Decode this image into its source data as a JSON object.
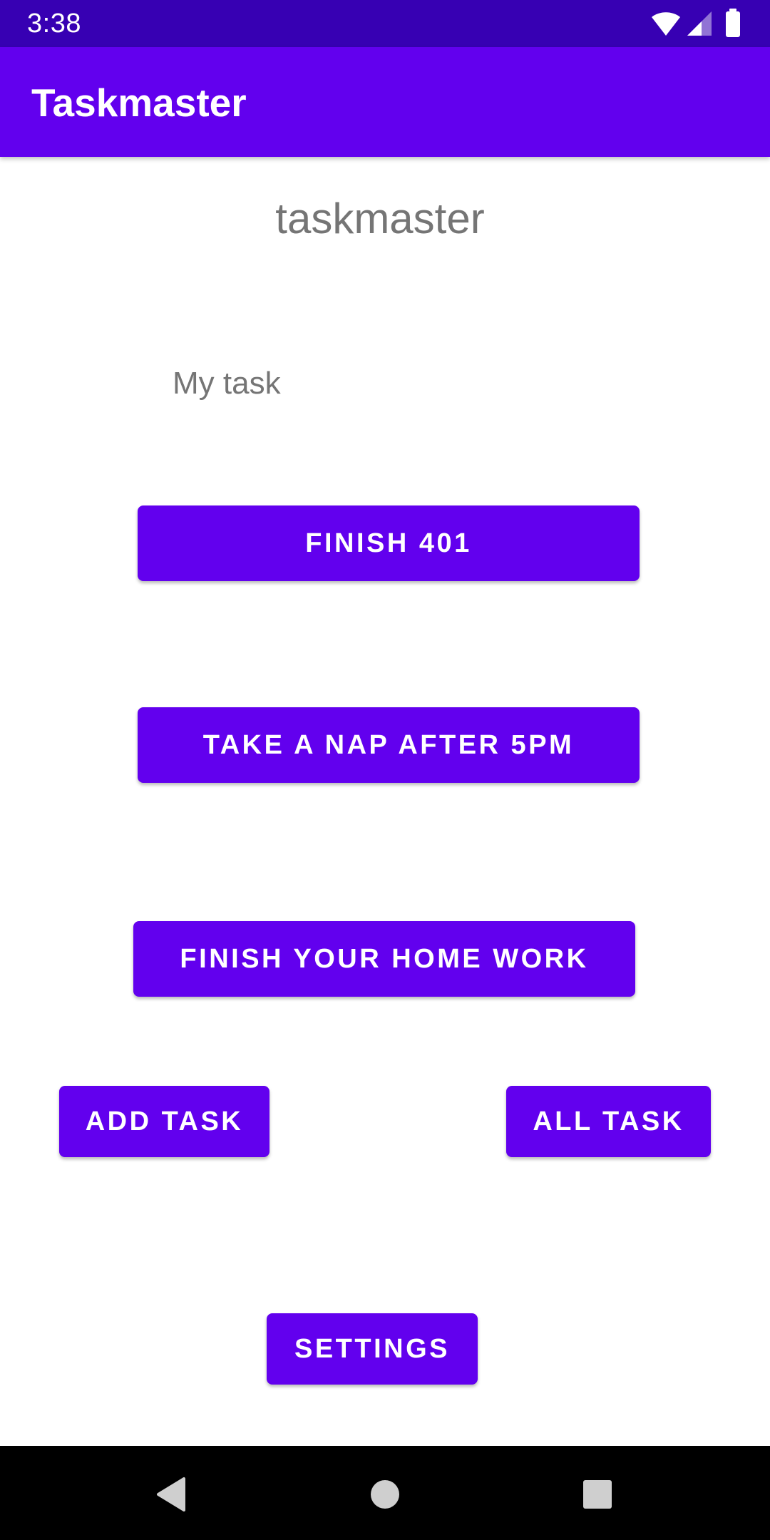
{
  "status_bar": {
    "time": "3:38",
    "icons": [
      "wifi-icon",
      "cellular-signal-icon",
      "battery-icon"
    ],
    "color": "#3700B3"
  },
  "app_bar": {
    "title": "Taskmaster",
    "color": "#6200EE"
  },
  "main": {
    "heading": "taskmaster",
    "section_label": "My task",
    "tasks": [
      {
        "label": "FINISH 401"
      },
      {
        "label": "TAKE A NAP AFTER 5PM"
      },
      {
        "label": "FINISH YOUR HOME WORK"
      }
    ],
    "add_task_label": "ADD TASK",
    "all_task_label": "ALL TASK",
    "settings_label": "SETTINGS",
    "button_color": "#6200EE"
  },
  "nav_bar": {
    "icons": [
      "back-icon",
      "home-icon",
      "recents-icon"
    ]
  }
}
